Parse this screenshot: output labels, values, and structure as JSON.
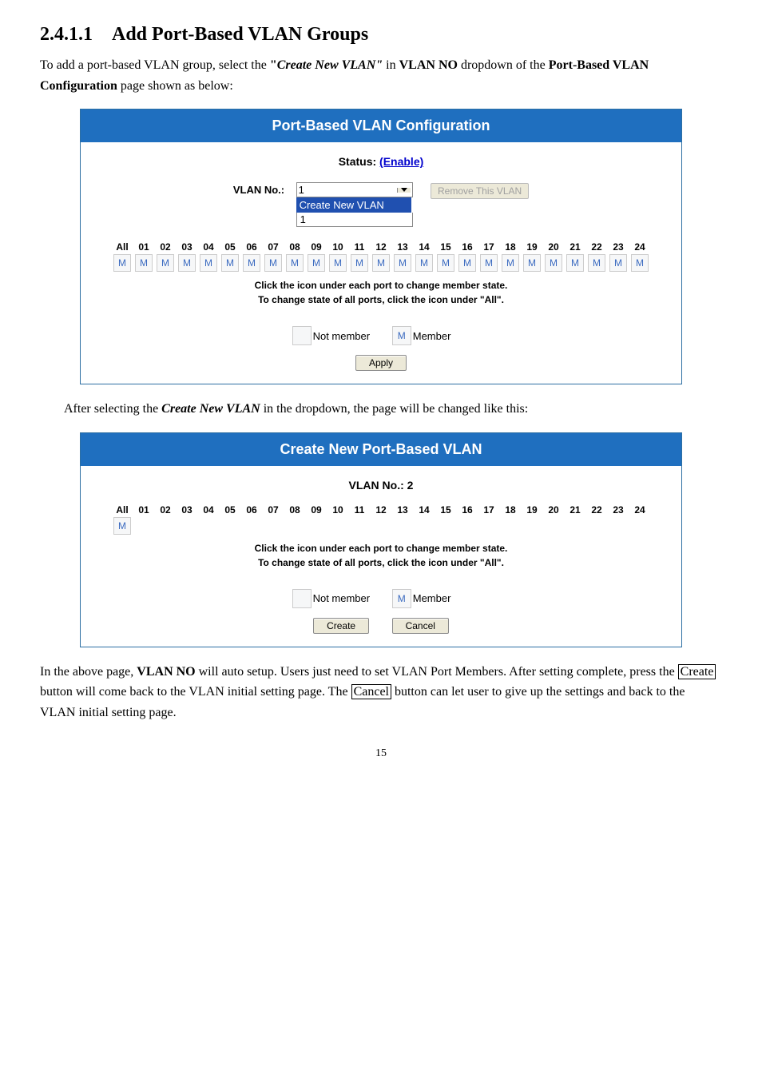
{
  "heading": {
    "number": "2.4.1.1",
    "title": "Add Port-Based VLAN Groups"
  },
  "intro": {
    "p1a": "To add a port-based VLAN group, select the ",
    "p1b": "\"",
    "p1c": "Create New VLAN\"",
    "p1d": " in ",
    "p1e": "VLAN NO",
    "p1f": " dropdown of the ",
    "p1g": "Port-Based VLAN Configuration",
    "p1h": " page shown as below:"
  },
  "panel1": {
    "title": "Port-Based VLAN Configuration",
    "status_label": "Status: ",
    "status_link": "(Enable)",
    "vlan_label": "VLAN No.:",
    "select_value": "1",
    "dropdown_option": "Create New VLAN",
    "dropdown_option2": "1",
    "remove_btn": "Remove This VLAN",
    "ports": {
      "all": "All",
      "headers": [
        "01",
        "02",
        "03",
        "04",
        "05",
        "06",
        "07",
        "08",
        "09",
        "10",
        "11",
        "12",
        "13",
        "14",
        "15",
        "16",
        "17",
        "18",
        "19",
        "20",
        "21",
        "22",
        "23",
        "24"
      ],
      "cell": "M"
    },
    "hint1": "Click the icon under each port to change member state.",
    "hint2": "To change state of all ports, click the icon under \"All\".",
    "legend_not": "Not member",
    "legend_mem": "Member",
    "legend_m": "M",
    "apply": "Apply"
  },
  "mid_text": {
    "a": "After selecting the ",
    "b": "Create New VLAN",
    "c": " in the dropdown, the page will be changed like this:"
  },
  "panel2": {
    "title": "Create New Port-Based VLAN",
    "vlan_no": "VLAN No.: 2",
    "ports": {
      "all": "All",
      "headers": [
        "01",
        "02",
        "03",
        "04",
        "05",
        "06",
        "07",
        "08",
        "09",
        "10",
        "11",
        "12",
        "13",
        "14",
        "15",
        "16",
        "17",
        "18",
        "19",
        "20",
        "21",
        "22",
        "23",
        "24"
      ],
      "cell": "M"
    },
    "hint1": "Click the icon under each port to change member state.",
    "hint2": "To change state of all ports, click the icon under \"All\".",
    "legend_not": "Not member",
    "legend_mem": "Member",
    "legend_m": "M",
    "create": "Create",
    "cancel": "Cancel"
  },
  "outro": {
    "a": "In the above page, ",
    "b": "VLAN NO",
    "c": " will auto setup. Users just need to set VLAN Port Members. After setting complete, press the ",
    "d": "Create",
    "e": " button will come back to the VLAN initial setting page. The ",
    "f": "Cancel",
    "g": " button can let user to give up the settings and back to the VLAN initial setting page."
  },
  "page_number": "15"
}
